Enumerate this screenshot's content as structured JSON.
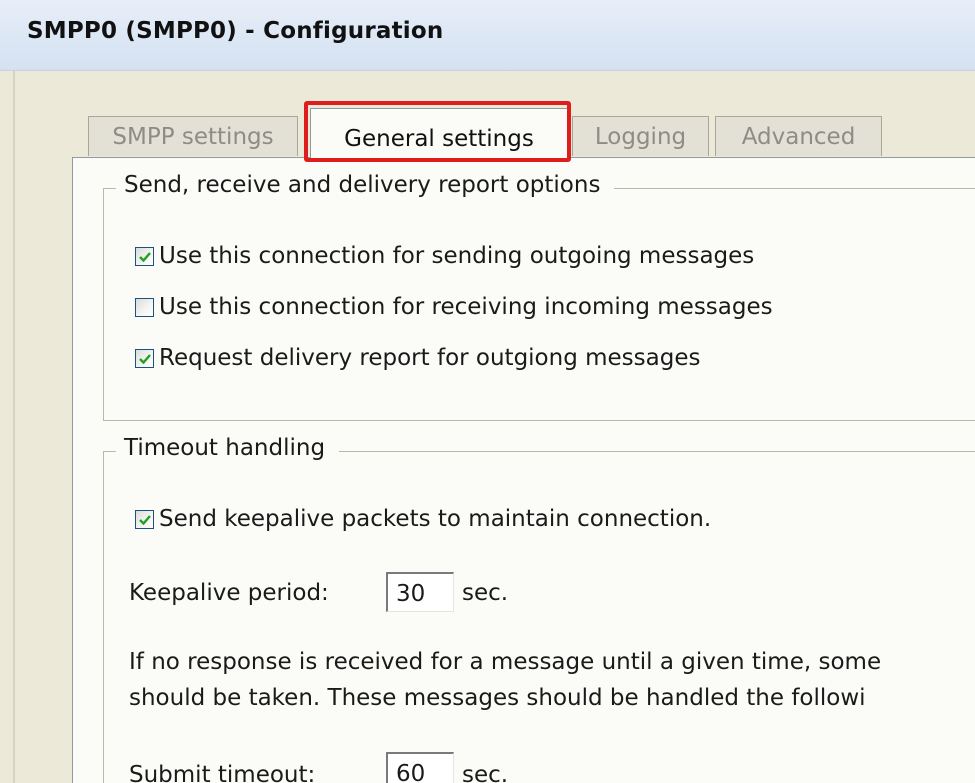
{
  "window": {
    "title": "SMPP0 (SMPP0) - Configuration"
  },
  "tabs": [
    {
      "label": "SMPP settings",
      "selected": false
    },
    {
      "label": "General settings",
      "selected": true
    },
    {
      "label": "Logging",
      "selected": false
    },
    {
      "label": "Advanced",
      "selected": false
    }
  ],
  "highlight": {
    "color": "#e01d1d",
    "target": "General settings"
  },
  "send_group": {
    "legend": "Send, receive and delivery report options",
    "options": [
      {
        "label": "Use this connection for sending outgoing messages",
        "checked": true
      },
      {
        "label": "Use this connection for receiving incoming messages",
        "checked": false
      },
      {
        "label": "Request delivery report for outgiong messages",
        "checked": true
      }
    ]
  },
  "timeout_group": {
    "legend": "Timeout handling",
    "keepalive_option": {
      "label": "Send keepalive packets to maintain connection.",
      "checked": true
    },
    "keepalive_period": {
      "label": "Keepalive period:",
      "value": "30",
      "unit": "sec."
    },
    "info_line_1": "If no response is received for a message until a given time, some",
    "info_line_2": "should be taken. These messages should be handled the followi",
    "submit_timeout": {
      "label": "Submit timeout:",
      "value": "60",
      "unit": "sec."
    }
  },
  "icons": {
    "checkbox_checked": "checkmark-icon"
  },
  "colors": {
    "checkmark": "#21a121",
    "checkbox_border": "#1c5180"
  }
}
